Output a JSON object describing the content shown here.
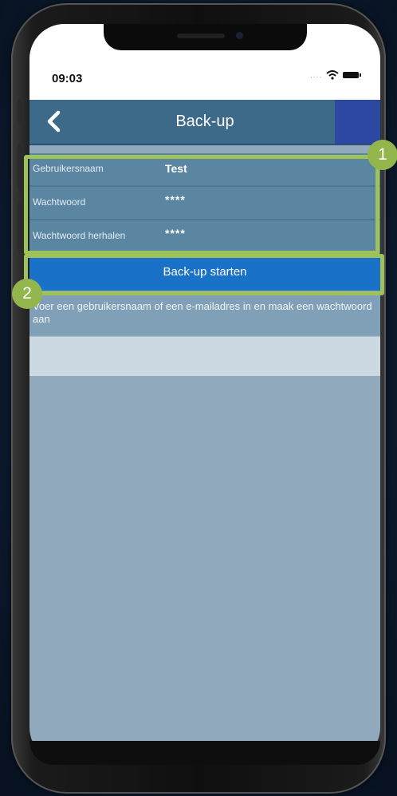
{
  "status_bar": {
    "time": "09:03",
    "signal_dots": "....",
    "wifi_icon": "wifi-icon",
    "battery_icon": "battery-icon"
  },
  "nav": {
    "title": "Back-up",
    "back_icon": "chevron-left-icon"
  },
  "form": {
    "username_label": "Gebruikersnaam",
    "username_value": "Test",
    "password_label": "Wachtwoord",
    "password_value": "****",
    "password_repeat_label": "Wachtwoord herhalen",
    "password_repeat_value": "****"
  },
  "start_button_label": "Back-up starten",
  "hint_text": "Voer een gebruikersnaam of een e-mailadres in en maak een wachtwoord aan",
  "callouts": {
    "first": "1",
    "second": "2"
  },
  "colors": {
    "accent_green": "#9ec259",
    "button_blue": "#1a72c8",
    "nav_bar": "#3e6a89",
    "form_row": "#5b86a2",
    "screen_bg": "#91a9bc"
  }
}
